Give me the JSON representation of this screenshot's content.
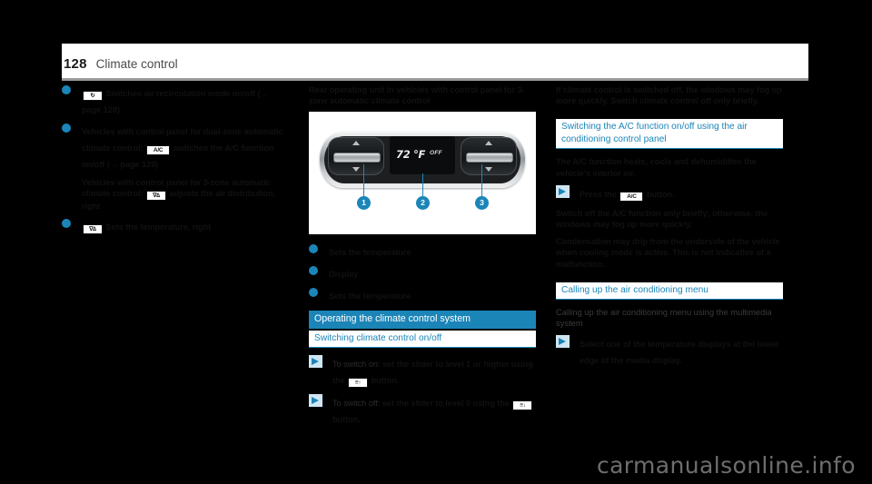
{
  "header": {
    "page_number": "128",
    "chapter": "Climate control"
  },
  "col1": {
    "bullets": [
      {
        "icon": "air-recirculation-icon",
        "icon_label": "↻",
        "text_before": "",
        "text_after": "Switches air recirculation mode on/off (→ page 128)"
      },
      {
        "icon": "ac-button-icon",
        "icon_label": "A/C",
        "text_before": "Vehicles with control panel for dual-zone automatic climate control:",
        "text_after": "switches the A/C function on/off (→ page 129)"
      },
      {
        "icon": "temperature-right-icon",
        "icon_label": "∇∆",
        "text_before": "",
        "text_after": "Sets the temperature, right"
      }
    ],
    "sub_paragraph": {
      "text_before": "Vehicles with control panel for 3-zone automatic climate control:",
      "icon": "air-distribution-icon",
      "icon_label": "∇∆",
      "text_after": "adjusts the air distribution, right"
    }
  },
  "col2": {
    "figure_caption": "Rear operating unit in vehicles with control panel for 3-zone automatic climate control",
    "display": {
      "temperature": "72 °F",
      "ac_status": "OFF"
    },
    "callouts": [
      "1",
      "2",
      "3"
    ],
    "legend": [
      "Sets the temperature",
      "Display",
      "Sets the temperature"
    ],
    "heading_bar": "Operating the climate control system",
    "heading_sub": "Switching climate control on/off",
    "steps": [
      {
        "lead": "To switch on:",
        "text_before": "set the slider to level 1 or higher using the",
        "icon": "fan-speed-icon",
        "icon_label": "≡↑",
        "text_after": "button."
      },
      {
        "lead": "To switch off:",
        "text_before": "set the slider to level 0 using the",
        "icon": "fan-speed-icon",
        "icon_label": "≡↓",
        "text_after": "button."
      }
    ]
  },
  "col3": {
    "intro_paragraph": "If climate control is switched off, the windows may fog up more quickly. Switch climate control off only briefly.",
    "heading_sub_1": "Switching the A/C function on/off using the air conditioning control panel",
    "paragraph_1": "The A/C function heats, cools and dehumidifies the vehicle's interior air.",
    "step": {
      "text_before": "Press the",
      "icon": "ac-button-icon",
      "icon_label": "A/C",
      "text_after": "button."
    },
    "paragraph_2": "Switch off the A/C function only briefly; otherwise, the windows may fog up more quickly.",
    "paragraph_3": "Condensation may drip from the underside of the vehicle when cooling mode is active. This is not indicative of a malfunction.",
    "heading_sub_2": "Calling up the air conditioning menu",
    "subheading": "Calling up the air conditioning menu using the multimedia system",
    "step_2": {
      "text": "Select one of the temperature displays at the lower edge of the media display."
    }
  },
  "watermark": "carmanualsonline.info",
  "colors": {
    "accent_blue": "#1b85b8",
    "light_blue": "#cfe6f2",
    "text": "#111111"
  }
}
